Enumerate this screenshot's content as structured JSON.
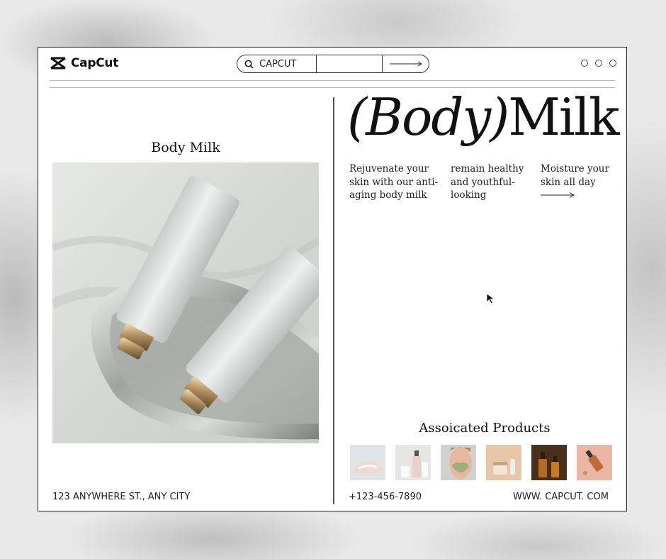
{
  "app": {
    "brand": "CapCut"
  },
  "search": {
    "value": "CAPCUT"
  },
  "left": {
    "title": "Body Milk"
  },
  "hero": {
    "title_italic": "(Body)",
    "title_rest": "Milk"
  },
  "descriptions": [
    {
      "lines": [
        "Rejuvenate your",
        "skin with our anti-",
        "aging body milk"
      ]
    },
    {
      "lines": [
        "remain healthy",
        "and youthful-",
        "looking"
      ]
    },
    {
      "lines": [
        "Moisture your",
        "skin all day"
      ]
    }
  ],
  "associated": {
    "title": "Assoicated Products"
  },
  "footer": {
    "address": "123 ANYWHERE ST., ANY CITY",
    "phone": "+123-456-7890",
    "website": "WWW. CAPCUT. COM"
  }
}
